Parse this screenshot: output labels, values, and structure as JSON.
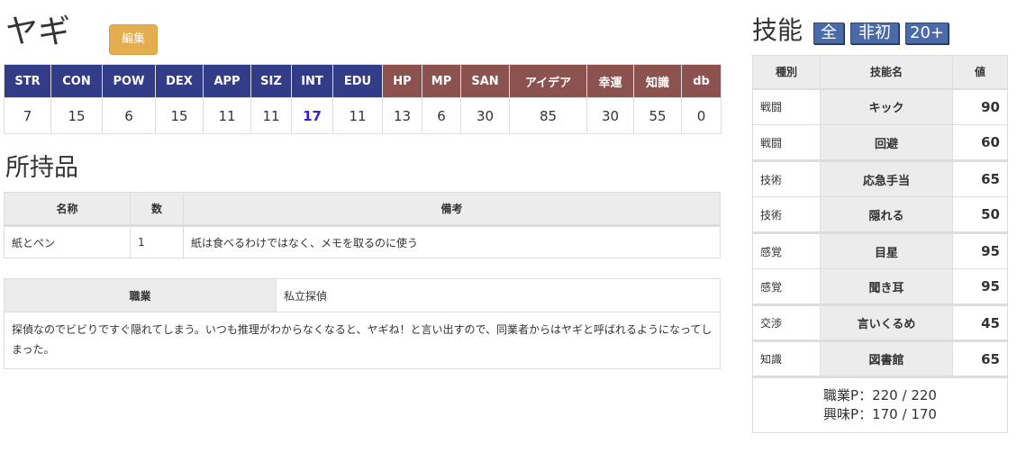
{
  "character": {
    "name": "ヤギ",
    "edit_label": "編集"
  },
  "stats": {
    "headers": [
      "STR",
      "CON",
      "POW",
      "DEX",
      "APP",
      "SIZ",
      "INT",
      "EDU",
      "HP",
      "MP",
      "SAN",
      "アイデア",
      "幸運",
      "知識",
      "db"
    ],
    "values": [
      "7",
      "15",
      "6",
      "15",
      "11",
      "11",
      "17",
      "11",
      "13",
      "6",
      "30",
      "85",
      "30",
      "55",
      "0"
    ],
    "highlighted": "INT",
    "colors": {
      "base_header": "#333d87",
      "derived_header": "#8b5250",
      "highlight_value": "#3a1fd1"
    }
  },
  "inventory": {
    "title": "所持品",
    "headers": [
      "名称",
      "数",
      "備考"
    ],
    "rows": [
      {
        "name": "紙とペン",
        "count": "1",
        "note": "紙は食べるわけではなく、メモを取るのに使う"
      }
    ]
  },
  "occupation": {
    "label": "職業",
    "value": "私立探偵",
    "description": "探偵なのでビビりですぐ隠れてしまう。いつも推理がわからなくなると、ヤギね！と言い出すので、同業者からはヤギと呼ばれるようになってしまった。"
  },
  "skills": {
    "title": "技能",
    "filters": [
      "全",
      "非初",
      "20+"
    ],
    "headers": [
      "種別",
      "技能名",
      "値"
    ],
    "rows": [
      {
        "category": "戦闘",
        "name": "キック",
        "value": "90"
      },
      {
        "category": "戦闘",
        "name": "回避",
        "value": "60"
      },
      {
        "category": "技術",
        "name": "応急手当",
        "value": "65"
      },
      {
        "category": "技術",
        "name": "隠れる",
        "value": "50"
      },
      {
        "category": "感覚",
        "name": "目星",
        "value": "95"
      },
      {
        "category": "感覚",
        "name": "聞き耳",
        "value": "95"
      },
      {
        "category": "交渉",
        "name": "言いくるめ",
        "value": "45"
      },
      {
        "category": "知識",
        "name": "図書館",
        "value": "65"
      }
    ],
    "occupation_points": "職業P：220 / 220",
    "interest_points": "興味P：170 / 170",
    "filter_color": "#4a6aa8"
  }
}
